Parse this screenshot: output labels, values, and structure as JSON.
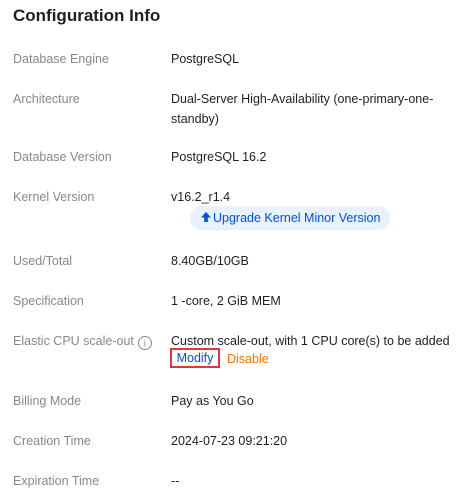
{
  "title": "Configuration Info",
  "rows": [
    {
      "label": "Database Engine",
      "value": "PostgreSQL"
    },
    {
      "label": "Architecture",
      "value": "Dual-Server High-Availability (one-primary-one-standby)"
    },
    {
      "label": "Database Version",
      "value": "PostgreSQL 16.2"
    },
    {
      "label": "Kernel Version",
      "value": "v16.2_r1.4"
    },
    {
      "label": "Used/Total",
      "value": "8.40GB/10GB"
    },
    {
      "label": "Specification",
      "value": "1 -core, 2 GiB MEM"
    },
    {
      "label": "Elastic CPU scale-out",
      "value": "Custom scale-out, with 1 CPU core(s) to be added"
    },
    {
      "label": "Billing Mode",
      "value": "Pay as You Go"
    },
    {
      "label": "Creation Time",
      "value": "2024-07-23 09:21:20"
    },
    {
      "label": "Expiration Time",
      "value": "--"
    }
  ],
  "actions": {
    "upgrade_kernel_label": "Upgrade Kernel Minor Version",
    "modify_label": "Modify",
    "disable_label": "Disable"
  },
  "icons": {
    "help": "info-circle-icon",
    "upgrade": "arrow-up-icon"
  },
  "colors": {
    "link": "#0052d9",
    "warning": "#ff7200",
    "highlight_border": "#e8343a",
    "label": "#888888"
  }
}
